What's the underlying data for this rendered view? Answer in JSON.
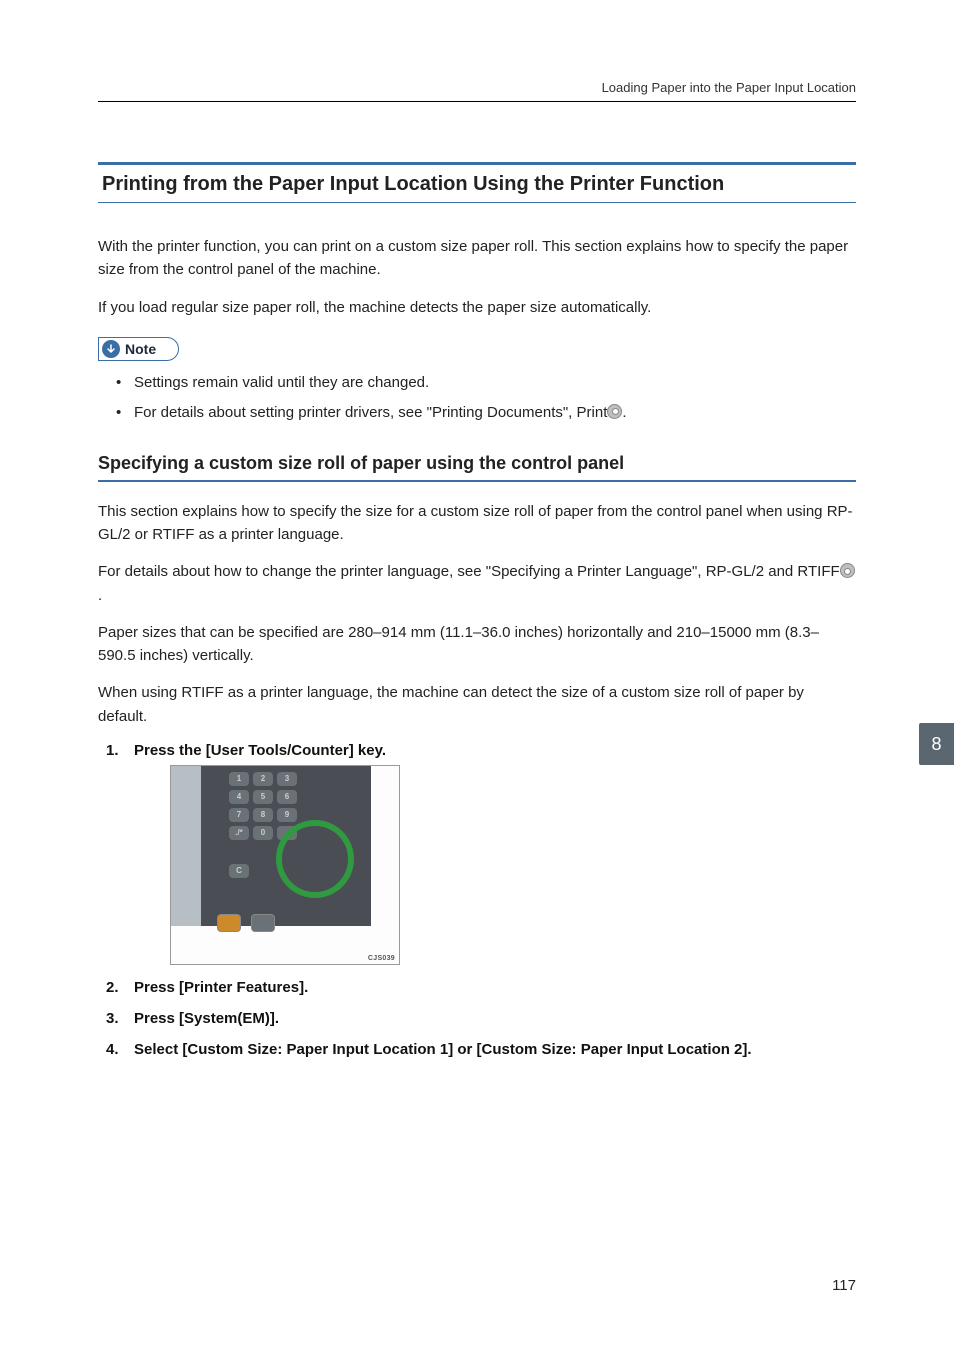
{
  "header": {
    "breadcrumb": "Loading Paper into the Paper Input Location"
  },
  "section": {
    "title": "Printing from the Paper Input Location Using the Printer Function"
  },
  "para1": "With the printer function, you can print on a custom size paper roll. This section explains how to specify the paper size from the control panel of the machine.",
  "para2": "If you load regular size paper roll, the machine detects the paper size automatically.",
  "note": {
    "label": "Note"
  },
  "notes": [
    "Settings remain valid until they are changed.",
    "For details about setting printer drivers, see \"Printing Documents\", Print"
  ],
  "sub": {
    "title": "Specifying a custom size roll of paper using the control panel"
  },
  "sub_para1": "This section explains how to specify the size for a custom size roll of paper from the control panel when using RP-GL/2 or RTIFF as a printer language.",
  "sub_para2a": "For details about how to change the printer language, see \"Specifying a Printer Language\", RP-GL/2 and RTIFF",
  "sub_para2b": ".",
  "sub_para3": "Paper sizes that can be specified are 280–914 mm (11.1–36.0 inches) horizontally and 210–15000 mm (8.3–590.5 inches) vertically.",
  "sub_para4": "When using RTIFF as a printer language, the machine can detect the size of a custom size roll of paper by default.",
  "steps": [
    "Press the [User Tools/Counter] key.",
    "Press [Printer Features].",
    "Press [System(EM)].",
    "Select [Custom Size: Paper Input Location 1] or [Custom Size: Paper Input Location 2]."
  ],
  "figure": {
    "code": "CJS039"
  },
  "sideTab": "8",
  "pageNum": "117"
}
